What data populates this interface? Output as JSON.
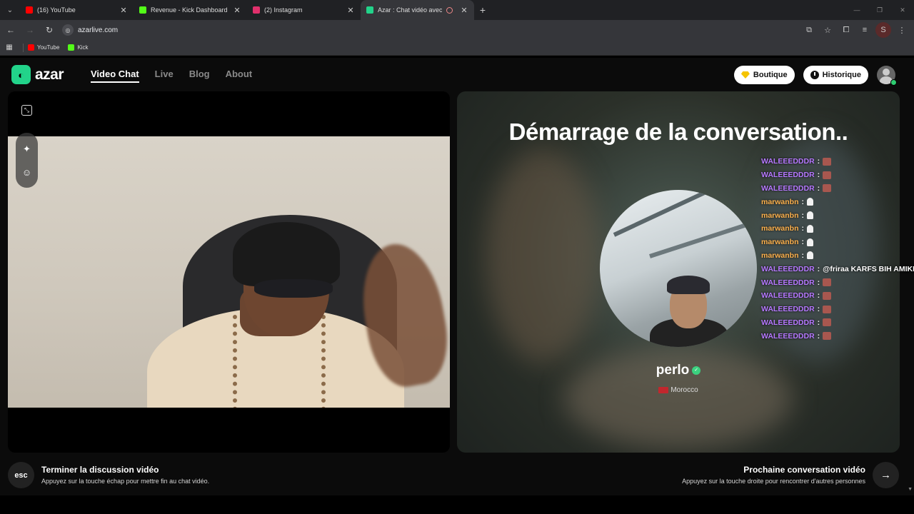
{
  "browser": {
    "tabs": [
      {
        "title": "(16) YouTube",
        "color": "#ff0000",
        "active": false
      },
      {
        "title": "Revenue - Kick Dashboard",
        "color": "#53fc18",
        "active": false
      },
      {
        "title": "(2) Instagram",
        "color": "#e1306c",
        "active": false
      },
      {
        "title": "Azar : Chat vidéo avec de n",
        "color": "#22d38a",
        "active": true
      }
    ],
    "url": "azarlive.com",
    "bookmarks": [
      {
        "label": "YouTube",
        "color": "#ff0000"
      },
      {
        "label": "Kick",
        "color": "#53fc18"
      }
    ],
    "profile_initial": "S"
  },
  "site": {
    "logo_text": "azar",
    "nav": [
      {
        "label": "Video Chat",
        "active": true
      },
      {
        "label": "Live",
        "active": false
      },
      {
        "label": "Blog",
        "active": false
      },
      {
        "label": "About",
        "active": false
      }
    ],
    "shop_label": "Boutique",
    "history_label": "Historique"
  },
  "match": {
    "status_title": "Démarrage de la conversation..",
    "peer_name": "perlo",
    "peer_country": "Morocco"
  },
  "chat": [
    {
      "user": "WALEEEDDDR",
      "msg": "",
      "kind": "emote",
      "color": "purple"
    },
    {
      "user": "WALEEEDDDR",
      "msg": "",
      "kind": "emote",
      "color": "purple"
    },
    {
      "user": "WALEEEDDDR",
      "msg": "",
      "kind": "emote",
      "color": "purple"
    },
    {
      "user": "marwanbn",
      "msg": "",
      "kind": "ghost",
      "color": "orange"
    },
    {
      "user": "marwanbn",
      "msg": "",
      "kind": "ghost",
      "color": "orange"
    },
    {
      "user": "marwanbn",
      "msg": "",
      "kind": "ghost",
      "color": "orange"
    },
    {
      "user": "marwanbn",
      "msg": "",
      "kind": "ghost",
      "color": "orange"
    },
    {
      "user": "marwanbn",
      "msg": "",
      "kind": "ghost",
      "color": "orange"
    },
    {
      "user": "WALEEEDDDR",
      "msg": "@friraa KARFS BIH AMIKHI",
      "kind": "text",
      "color": "purple"
    },
    {
      "user": "WALEEEDDDR",
      "msg": "",
      "kind": "emote",
      "color": "purple"
    },
    {
      "user": "WALEEEDDDR",
      "msg": "",
      "kind": "emote",
      "color": "purple"
    },
    {
      "user": "WALEEEDDDR",
      "msg": "",
      "kind": "emote",
      "color": "purple"
    },
    {
      "user": "WALEEEDDDR",
      "msg": "",
      "kind": "emote",
      "color": "purple"
    },
    {
      "user": "WALEEEDDDR",
      "msg": "",
      "kind": "emote",
      "color": "purple"
    }
  ],
  "footer": {
    "esc_key": "esc",
    "end_title": "Terminer la discussion vidéo",
    "end_sub": "Appuyez sur la touche échap pour mettre fin au chat vidéo.",
    "next_title": "Prochaine conversation vidéo",
    "next_sub": "Appuyez sur la touche droite pour rencontrer d'autres personnes"
  },
  "colors": {
    "brand": "#22d38a",
    "chat_purple": "#b678ff",
    "chat_orange": "#ffb24d"
  }
}
